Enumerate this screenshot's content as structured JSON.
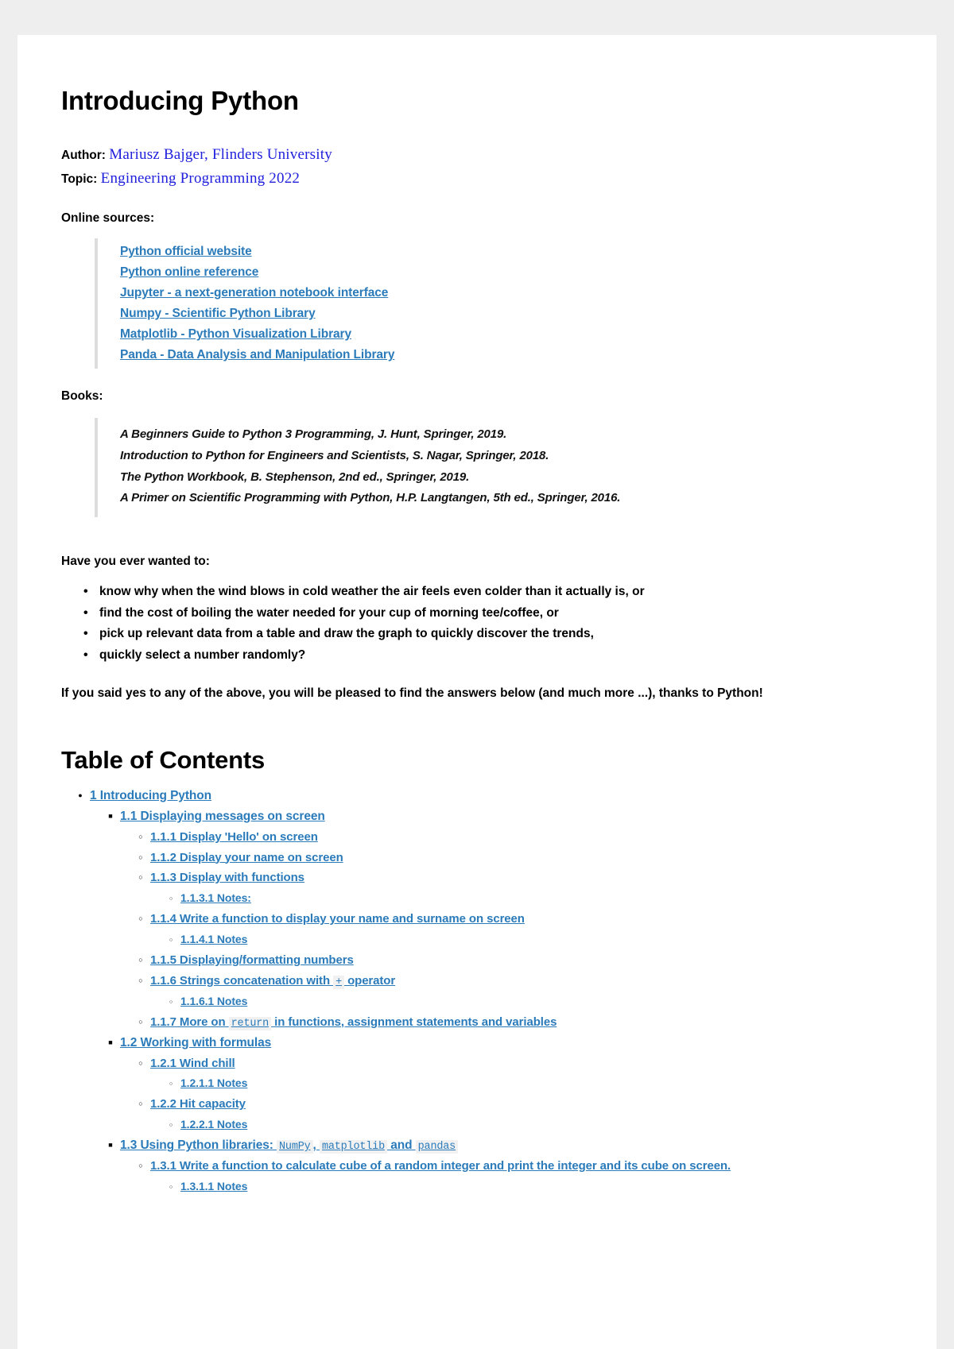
{
  "document": {
    "title": "Introducing Python",
    "author_label": "Author:",
    "author_value": "Mariusz Bajger, Flinders University",
    "topic_label": "Topic:",
    "topic_value": "Engineering Programming 2022",
    "online_sources_label": "Online sources:",
    "books_label": "Books:",
    "intro_question": "Have you ever wanted to:",
    "closing_paragraph": "If you said yes to any of the above, you will be pleased to find the answers below (and much more ...), thanks to Python!",
    "toc_title": "Table of Contents"
  },
  "online_sources": [
    {
      "label": "Python official website"
    },
    {
      "label": "Python online reference"
    },
    {
      "label": "Jupyter - a next-generation notebook interface"
    },
    {
      "label": "Numpy - Scientific Python Library"
    },
    {
      "label": "Matplotlib - Python Visualization Library"
    },
    {
      "label": "Panda - Data Analysis and Manipulation Library"
    }
  ],
  "books": [
    {
      "citation": "A Beginners Guide to Python 3 Programming, J. Hunt, Springer, 2019."
    },
    {
      "citation": "Introduction to Python for Engineers and Scientists, S. Nagar, Springer, 2018."
    },
    {
      "citation": "The Python Workbook, B. Stephenson, 2nd ed., Springer, 2019."
    },
    {
      "citation": "A Primer on Scientific Programming with Python, H.P. Langtangen, 5th ed., Springer, 2016."
    }
  ],
  "questions": [
    {
      "text": "know why when the wind blows in cold weather the air feels even colder than it actually is, or"
    },
    {
      "text": "find the cost of boiling the water needed for your cup of morning tee/coffee, or"
    },
    {
      "text": "pick up relevant data from a table and draw the graph to quickly discover the trends,"
    },
    {
      "text": "quickly select a number randomly?"
    }
  ],
  "toc": {
    "ch1": "1  Introducing Python",
    "s11": "1.1  Displaying messages on screen",
    "s111": "1.1.1  Display 'Hello' on screen",
    "s112": "1.1.2  Display your name on screen",
    "s113": "1.1.3  Display with functions",
    "s1131": "1.1.3.1  Notes:",
    "s114": "1.1.4  Write a function to display your name and surname on screen",
    "s1141": "1.1.4.1  Notes",
    "s115": "1.1.5  Displaying/formatting numbers",
    "s116_a": "1.1.6  Strings concatenation with ",
    "s116_code": "+",
    "s116_b": " operator",
    "s1161": "1.1.6.1  Notes",
    "s117_a": "1.1.7  More on ",
    "s117_code": "return",
    "s117_b": " in functions, assignment statements and variables",
    "s12": "1.2  Working with formulas",
    "s121": "1.2.1  Wind chill",
    "s1211": "1.2.1.1  Notes",
    "s122": "1.2.2  Hit capacity",
    "s1221": "1.2.2.1  Notes",
    "s13_a": "1.3  Using Python libraries: ",
    "s13_code1": "NumPy",
    "s13_sep1": ", ",
    "s13_code2": "matplotlib",
    "s13_sep2": " and ",
    "s13_code3": "pandas",
    "s131": "1.3.1  Write a function to calculate cube of a random integer and print the integer and its cube on screen.",
    "s1311": "1.3.1.1  Notes"
  },
  "colors": {
    "link": "#2b7bba",
    "serif_blue": "#2020dd",
    "page_background": "#ffffff",
    "canvas_background": "#eeeeee",
    "quote_border": "#dddddd",
    "code_background": "#f1f1f1"
  }
}
